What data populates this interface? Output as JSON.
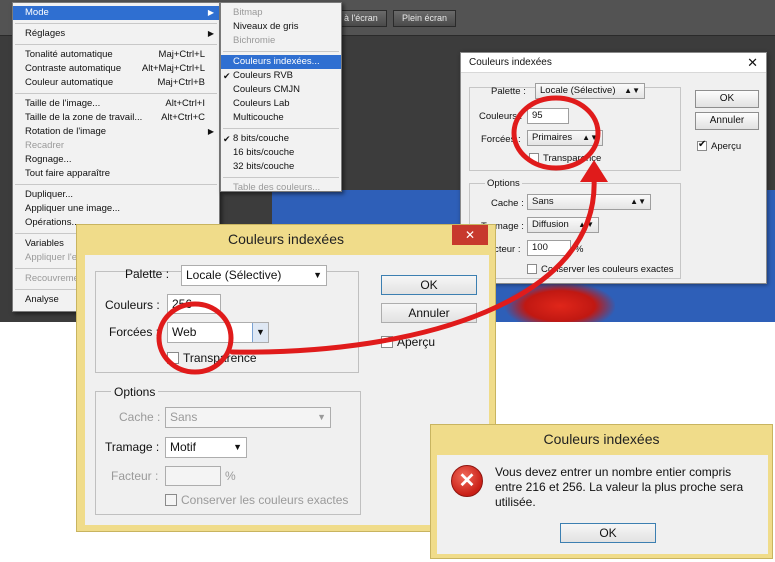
{
  "ps": {
    "buttons": [
      "à l'écran",
      "Plein écran"
    ]
  },
  "image_menu": {
    "items": [
      {
        "label": "Mode",
        "shortcut": "",
        "state": "selected",
        "submenu": true
      },
      {
        "label": "Réglages",
        "shortcut": "",
        "state": "normal",
        "submenu": true
      },
      {
        "label": "Tonalité automatique",
        "shortcut": "Maj+Ctrl+L",
        "state": "normal",
        "submenu": false
      },
      {
        "label": "Contraste automatique",
        "shortcut": "Alt+Maj+Ctrl+L",
        "state": "normal",
        "submenu": false
      },
      {
        "label": "Couleur automatique",
        "shortcut": "Maj+Ctrl+B",
        "state": "normal",
        "submenu": false
      },
      {
        "label": "Taille de l'image...",
        "shortcut": "Alt+Ctrl+I",
        "state": "normal",
        "submenu": false
      },
      {
        "label": "Taille de la zone de travail...",
        "shortcut": "Alt+Ctrl+C",
        "state": "normal",
        "submenu": false
      },
      {
        "label": "Rotation de l'image",
        "shortcut": "",
        "state": "normal",
        "submenu": true
      },
      {
        "label": "Recadrer",
        "shortcut": "",
        "state": "disabled",
        "submenu": false
      },
      {
        "label": "Rognage...",
        "shortcut": "",
        "state": "normal",
        "submenu": false
      },
      {
        "label": "Tout faire apparaître",
        "shortcut": "",
        "state": "normal",
        "submenu": false
      },
      {
        "label": "Dupliquer...",
        "shortcut": "",
        "state": "normal",
        "submenu": false
      },
      {
        "label": "Appliquer une image...",
        "shortcut": "",
        "state": "normal",
        "submenu": false
      },
      {
        "label": "Opérations...",
        "shortcut": "",
        "state": "normal",
        "submenu": false
      },
      {
        "label": "Variables",
        "shortcut": "",
        "state": "normal",
        "submenu": true
      },
      {
        "label": "Appliquer l'e",
        "shortcut": "",
        "state": "disabled",
        "submenu": false
      },
      {
        "label": "Recouvreme",
        "shortcut": "",
        "state": "disabled",
        "submenu": false
      },
      {
        "label": "Analyse",
        "shortcut": "",
        "state": "normal",
        "submenu": true
      }
    ]
  },
  "mode_submenu": {
    "items": [
      {
        "label": "Bitmap",
        "state": "disabled",
        "checked": false
      },
      {
        "label": "Niveaux de gris",
        "state": "normal",
        "checked": false
      },
      {
        "label": "Bichromie",
        "state": "disabled",
        "checked": false
      },
      {
        "label": "Couleurs indexées...",
        "state": "selected",
        "checked": false
      },
      {
        "label": "Couleurs RVB",
        "state": "normal",
        "checked": true
      },
      {
        "label": "Couleurs CMJN",
        "state": "normal",
        "checked": false
      },
      {
        "label": "Couleurs Lab",
        "state": "normal",
        "checked": false
      },
      {
        "label": "Multicouche",
        "state": "normal",
        "checked": false
      },
      {
        "label": "8 bits/couche",
        "state": "normal",
        "checked": true
      },
      {
        "label": "16 bits/couche",
        "state": "normal",
        "checked": false
      },
      {
        "label": "32 bits/couche",
        "state": "normal",
        "checked": false
      },
      {
        "label": "Table des couleurs...",
        "state": "disabled",
        "checked": false
      }
    ]
  },
  "small_dialog": {
    "title": "Couleurs indexées",
    "close": "✕",
    "palette_label": "Palette :",
    "palette_value": "Locale (Sélective)",
    "colors_label": "Couleurs :",
    "colors_value": "95",
    "forced_label": "Forcées :",
    "forced_value": "Primaires",
    "transparency_label": "Transparence",
    "options_label": "Options",
    "cache_label": "Cache :",
    "cache_value": "Sans",
    "dither_label": "Tramage :",
    "dither_value": "Diffusion",
    "factor_label": "Facteur :",
    "factor_value": "100",
    "factor_unit": "%",
    "preserve_label": "Conserver les couleurs exactes",
    "ok": "OK",
    "cancel": "Annuler",
    "preview_label": "Aperçu"
  },
  "big_dialog": {
    "title": "Couleurs indexées",
    "close": "✕",
    "palette_label": "Palette :",
    "palette_value": "Locale (Sélective)",
    "colors_label": "Couleurs :",
    "colors_value": "256",
    "forced_label": "Forcées :",
    "forced_value": "Web",
    "transparency_label": "Transparence",
    "options_label": "Options",
    "cache_label": "Cache :",
    "cache_value": "Sans",
    "dither_label": "Tramage :",
    "dither_value": "Motif",
    "factor_label": "Facteur :",
    "factor_value": "",
    "factor_unit": "%",
    "preserve_label": "Conserver les couleurs exactes",
    "ok": "OK",
    "cancel": "Annuler",
    "preview_label": "Aperçu"
  },
  "error_dialog": {
    "title": "Couleurs indexées",
    "message": "Vous devez entrer un nombre entier compris entre 216 et 256. La valeur la plus proche sera utilisée.",
    "ok": "OK"
  }
}
